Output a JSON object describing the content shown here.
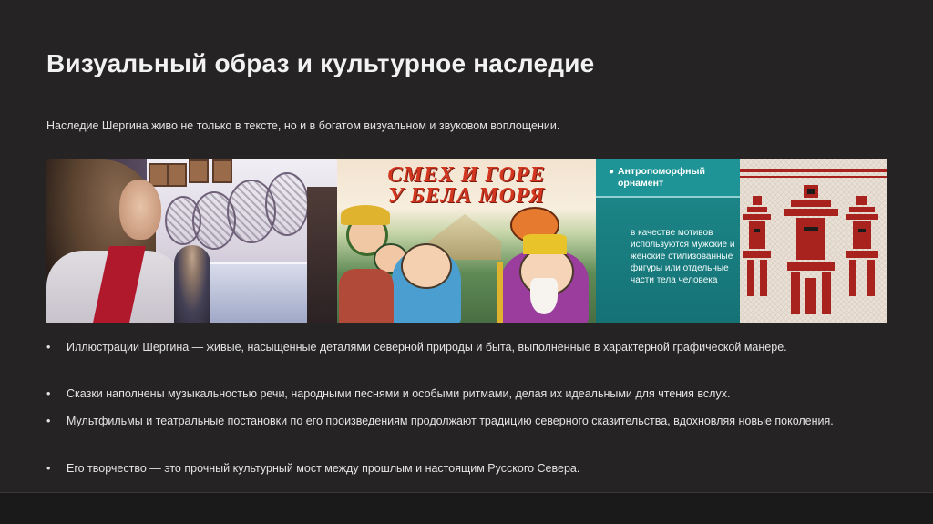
{
  "slide": {
    "title": "Визуальный образ и культурное наследие",
    "subtitle": "Наследие Шергина живо не только в тексте, но и в богатом визуальном и звуковом воплощении."
  },
  "images": {
    "book_cover_title_line1": "СМЕХ И ГОРЕ",
    "book_cover_title_line2": "У БЕЛА МОРЯ",
    "ornament_heading": "Антропоморфный орнамент",
    "ornament_heading_bullet": "●",
    "ornament_body": "в качестве мотивов используются мужские и женские стилизованные фигуры или отдельные части тела человека"
  },
  "bullets": [
    {
      "marker": "•",
      "text": "Иллюстрации Шергина — живые, насыщенные деталями северной природы и быта, выполненные в характерной графической манере."
    },
    {
      "marker": "•",
      "text": "Сказки наполнены музыкальностью речи, народными песнями и особыми ритмами, делая их идеальными для чтения вслух."
    },
    {
      "marker": "•",
      "text": "Мультфильмы и театральные постановки по его произведениям продолжают традицию северного сказительства, вдохновляя новые поколения."
    },
    {
      "marker": "•",
      "text": "Его творчество — это прочный культурный мост между прошлым и настоящим Русского Севера."
    }
  ],
  "colors": {
    "background": "#252323",
    "teal_panel": "#1e8a8c",
    "ornament_red": "#a8231e",
    "book_title_red": "#d2361f"
  }
}
